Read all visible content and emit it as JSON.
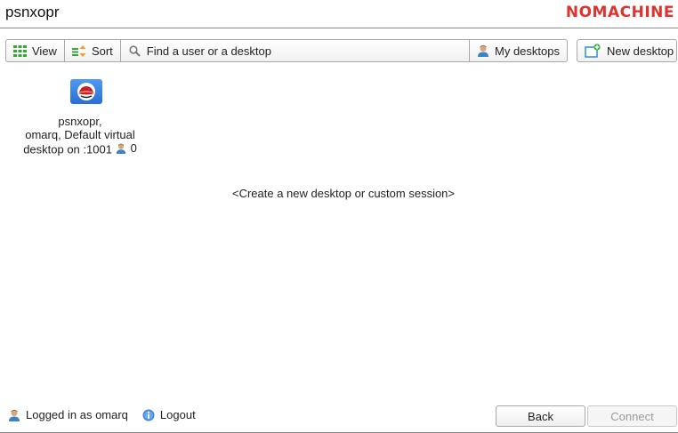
{
  "window": {
    "title": "psnxopr",
    "brand": "NOMACHINE"
  },
  "toolbar": {
    "view_label": "View",
    "sort_label": "Sort",
    "search_placeholder": "Find a user or a desktop",
    "my_desktops_label": "My desktops",
    "new_desktop_label": "New desktop"
  },
  "sessions": [
    {
      "os_icon": "redhat-icon",
      "line1": "psnxopr,",
      "line2": "omarq, Default virtual",
      "line3": "desktop on :1001",
      "user_count": "0"
    }
  ],
  "main": {
    "create_link": "<Create a new desktop or custom session>"
  },
  "footer": {
    "logged_in_text": "Logged in as omarq",
    "logout_label": "Logout",
    "back_label": "Back",
    "connect_label": "Connect"
  },
  "colors": {
    "brand": "#e0322e",
    "accent_blue": "#2a6fd4",
    "disabled_text": "#9a9a9a"
  }
}
